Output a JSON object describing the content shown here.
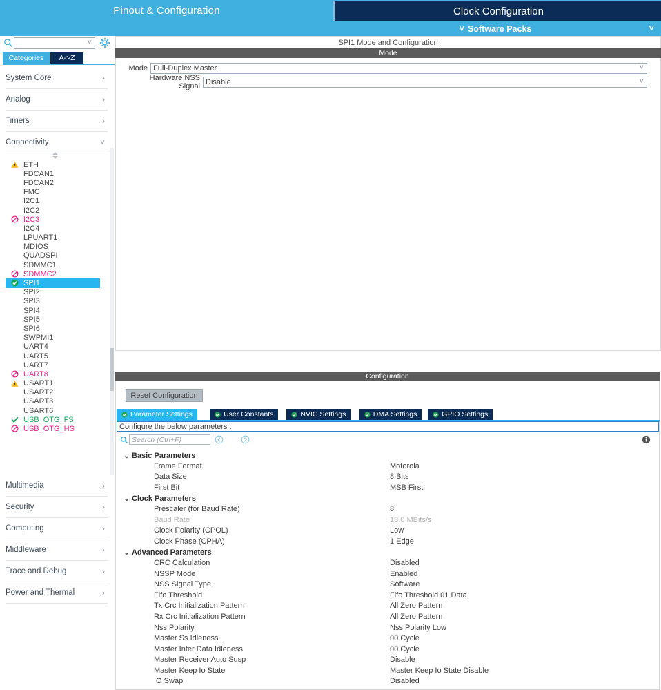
{
  "topbar": {
    "tabs": [
      {
        "label": "Pinout & Configuration",
        "active": false
      },
      {
        "label": "Clock Configuration",
        "active": true
      }
    ],
    "software_packs": "Software Packs",
    "caret_icon": "chevron-down-icon",
    "accent_blue": "#3fb0e0",
    "dark_navy": "#0b2c56"
  },
  "sidebar": {
    "search": {
      "value": "",
      "placeholder": "",
      "icon": "search-icon"
    },
    "gear_icon": "gear-icon",
    "view_tabs": [
      {
        "label": "Categories",
        "active": true
      },
      {
        "label": "A->Z",
        "active": false
      }
    ],
    "categories": [
      {
        "label": "System Core",
        "expanded": false,
        "arrow": "chevron-right-icon"
      },
      {
        "label": "Analog",
        "expanded": false,
        "arrow": "chevron-right-icon"
      },
      {
        "label": "Timers",
        "expanded": false,
        "arrow": "chevron-right-icon"
      },
      {
        "label": "Connectivity",
        "expanded": true,
        "arrow": "chevron-down-icon"
      }
    ],
    "peripherals": [
      {
        "label": "ETH",
        "status": "warning"
      },
      {
        "label": "FDCAN1",
        "status": "none"
      },
      {
        "label": "FDCAN2",
        "status": "none"
      },
      {
        "label": "FMC",
        "status": "none"
      },
      {
        "label": "I2C1",
        "status": "none"
      },
      {
        "label": "I2C2",
        "status": "none"
      },
      {
        "label": "I2C3",
        "status": "error"
      },
      {
        "label": "I2C4",
        "status": "none"
      },
      {
        "label": "LPUART1",
        "status": "none"
      },
      {
        "label": "MDIOS",
        "status": "none"
      },
      {
        "label": "QUADSPI",
        "status": "none"
      },
      {
        "label": "SDMMC1",
        "status": "none"
      },
      {
        "label": "SDMMC2",
        "status": "error"
      },
      {
        "label": "SPI1",
        "status": "check-selected",
        "selected": true
      },
      {
        "label": "SPI2",
        "status": "none"
      },
      {
        "label": "SPI3",
        "status": "none"
      },
      {
        "label": "SPI4",
        "status": "none"
      },
      {
        "label": "SPI5",
        "status": "none"
      },
      {
        "label": "SPI6",
        "status": "none"
      },
      {
        "label": "SWPMI1",
        "status": "none"
      },
      {
        "label": "UART4",
        "status": "none"
      },
      {
        "label": "UART5",
        "status": "none"
      },
      {
        "label": "UART7",
        "status": "none"
      },
      {
        "label": "UART8",
        "status": "error"
      },
      {
        "label": "USART1",
        "status": "warning"
      },
      {
        "label": "USART2",
        "status": "none"
      },
      {
        "label": "USART3",
        "status": "none"
      },
      {
        "label": "USART6",
        "status": "none"
      },
      {
        "label": "USB_OTG_FS",
        "status": "ok"
      },
      {
        "label": "USB_OTG_HS",
        "status": "error"
      }
    ],
    "categories_bottom": [
      {
        "label": "Multimedia",
        "arrow": "chevron-right-icon"
      },
      {
        "label": "Security",
        "arrow": "chevron-right-icon"
      },
      {
        "label": "Computing",
        "arrow": "chevron-right-icon"
      },
      {
        "label": "Middleware",
        "arrow": "chevron-right-icon"
      },
      {
        "label": "Trace and Debug",
        "arrow": "chevron-right-icon"
      },
      {
        "label": "Power and Thermal",
        "arrow": "chevron-right-icon"
      }
    ]
  },
  "main": {
    "panel_title": "SPI1 Mode and Configuration",
    "mode_section_label": "Mode",
    "mode_fields": [
      {
        "label": "Mode",
        "value": "Full-Duplex Master"
      },
      {
        "label": "Hardware NSS Signal",
        "value": "Disable"
      }
    ],
    "configuration_section_label": "Configuration",
    "reset_button": "Reset Configuration",
    "tabs": [
      {
        "label": "Parameter Settings",
        "active": true
      },
      {
        "label": "User Constants",
        "active": false
      },
      {
        "label": "NVIC Settings",
        "active": false
      },
      {
        "label": "DMA Settings",
        "active": false
      },
      {
        "label": "GPIO Settings",
        "active": false
      }
    ],
    "hint": "Configure the below parameters :",
    "search": {
      "placeholder": "Search (Ctrl+F)",
      "value": "",
      "icon": "search-icon"
    },
    "nav_prev_icon": "circle-left-arrow-icon",
    "nav_next_icon": "circle-right-arrow-icon",
    "info_icon": "info-icon",
    "parameter_groups": [
      {
        "group": "Basic Parameters",
        "expanded": true,
        "rows": [
          {
            "name": "Frame Format",
            "value": "Motorola",
            "dim": false
          },
          {
            "name": "Data Size",
            "value": "8 Bits",
            "dim": false
          },
          {
            "name": "First Bit",
            "value": "MSB First",
            "dim": false
          }
        ]
      },
      {
        "group": "Clock Parameters",
        "expanded": true,
        "rows": [
          {
            "name": "Prescaler (for Baud Rate)",
            "value": "8",
            "dim": false
          },
          {
            "name": "Baud Rate",
            "value": "18.0 MBits/s",
            "dim": true
          },
          {
            "name": "Clock Polarity (CPOL)",
            "value": "Low",
            "dim": false
          },
          {
            "name": "Clock Phase (CPHA)",
            "value": "1 Edge",
            "dim": false
          }
        ]
      },
      {
        "group": "Advanced Parameters",
        "expanded": true,
        "rows": [
          {
            "name": "CRC Calculation",
            "value": "Disabled",
            "dim": false
          },
          {
            "name": "NSSP Mode",
            "value": "Enabled",
            "dim": false
          },
          {
            "name": "NSS Signal Type",
            "value": "Software",
            "dim": false
          },
          {
            "name": "Fifo Threshold",
            "value": "Fifo Threshold 01 Data",
            "dim": false
          },
          {
            "name": "Tx Crc Initialization Pattern",
            "value": "All Zero Pattern",
            "dim": false
          },
          {
            "name": "Rx Crc Initialization Pattern",
            "value": "All Zero Pattern",
            "dim": false
          },
          {
            "name": "Nss Polarity",
            "value": "Nss Polarity Low",
            "dim": false
          },
          {
            "name": "Master Ss Idleness",
            "value": "00 Cycle",
            "dim": false
          },
          {
            "name": "Master Inter Data Idleness",
            "value": "00 Cycle",
            "dim": false
          },
          {
            "name": "Master Receiver Auto Susp",
            "value": "Disable",
            "dim": false
          },
          {
            "name": "Master Keep Io State",
            "value": "Master Keep Io State Disable",
            "dim": false
          },
          {
            "name": "IO Swap",
            "value": "Disabled",
            "dim": false
          }
        ]
      }
    ]
  }
}
